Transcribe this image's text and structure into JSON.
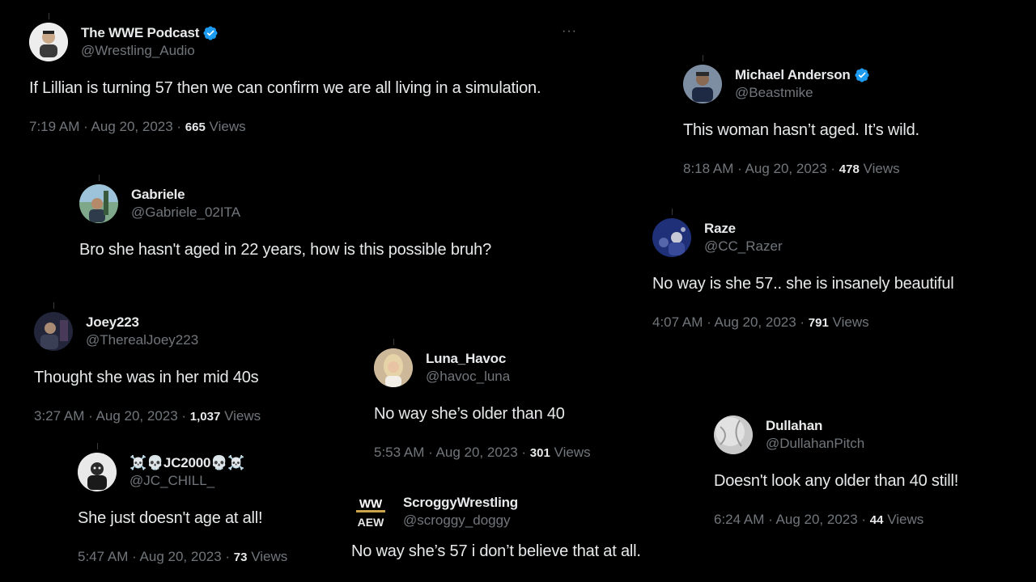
{
  "tweets": [
    {
      "display_name": "The WWE Podcast",
      "handle": "@Wrestling_Audio",
      "verified": true,
      "text": "If Lillian is turning 57 then we can confirm we are all living in a simulation.",
      "time": "7:19 AM · Aug 20, 2023 · ",
      "views_count": "665",
      "views_label": " Views",
      "more": "···",
      "avatar_icon": "wrestler-avatar-icon"
    },
    {
      "display_name": "Michael Anderson",
      "handle": "@Beastmike",
      "verified": true,
      "text": "This woman hasn’t aged. It’s wild.",
      "time": "8:18 AM · Aug 20, 2023 · ",
      "views_count": "478",
      "views_label": " Views",
      "avatar_icon": "person-avatar-icon"
    },
    {
      "display_name": "Gabriele",
      "handle": "@Gabriele_02ITA",
      "verified": false,
      "text": "Bro she hasn't aged in 22 years, how is this possible bruh?",
      "avatar_icon": "outdoor-avatar-icon"
    },
    {
      "display_name": "Raze",
      "handle": "@CC_Razer",
      "verified": false,
      "text": "No way is she 57.. she is insanely beautiful",
      "time": "4:07 AM · Aug 20, 2023 · ",
      "views_count": "791",
      "views_label": " Views",
      "avatar_icon": "crowd-avatar-icon"
    },
    {
      "display_name": "Joey223",
      "handle": "@TherealJoey223",
      "verified": false,
      "text": "Thought she was in her mid 40s",
      "time": "3:27 AM · Aug 20, 2023 · ",
      "views_count": "1,037",
      "views_label": " Views",
      "avatar_icon": "dark-avatar-icon"
    },
    {
      "display_name": "Luna_Havoc",
      "handle": "@havoc_luna",
      "verified": false,
      "text": "No way she’s older than 40",
      "time": "5:53 AM · Aug 20, 2023 · ",
      "views_count": "301",
      "views_label": " Views",
      "avatar_icon": "woman-avatar-icon"
    },
    {
      "display_name": "Dullahan",
      "handle": "@DullahanPitch",
      "verified": false,
      "text": "Doesn't look any older than 40 still!",
      "time": "6:24 AM · Aug 20, 2023 · ",
      "views_count": "44",
      "views_label": " Views",
      "avatar_icon": "baseball-avatar-icon"
    },
    {
      "display_name": "☠️💀JC2000💀☠️",
      "handle": "@JC_CHILL_",
      "verified": false,
      "text": "She just doesn't  age at all!",
      "time": "5:47 AM · Aug 20, 2023 · ",
      "views_count": "73",
      "views_label": " Views",
      "avatar_icon": "portrait-avatar-icon"
    },
    {
      "display_name": "ScroggyWrestling",
      "handle": "@scroggy_doggy",
      "verified": false,
      "text": "No way she’s 57 i don’t believe that at all.",
      "avatar_icon": "ww-aew-logo-icon",
      "logo_text_top": "WW",
      "logo_text_bottom": "AEW"
    }
  ],
  "colors": {
    "background": "#000000",
    "primary_text": "#e7e9ea",
    "secondary_text": "#71767b",
    "verified_blue": "#1d9bf0"
  }
}
